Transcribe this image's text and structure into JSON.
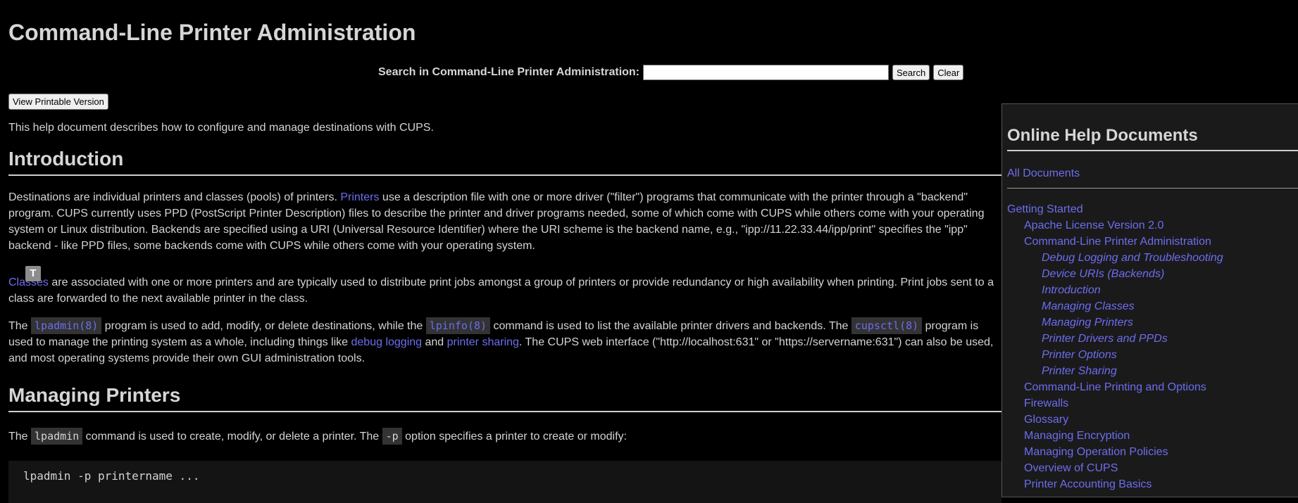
{
  "page": {
    "title": "Command-Line Printer Administration"
  },
  "search": {
    "label": "Search in Command-Line Printer Administration:",
    "value": "",
    "placeholder": "",
    "search_label": "Search",
    "clear_label": "Clear"
  },
  "print_button": "View Printable Version",
  "intro_line": "This help document describes how to configure and manage destinations with CUPS.",
  "sections": {
    "introduction": "Introduction",
    "managing_printers": "Managing Printers"
  },
  "badge": "T",
  "p1": {
    "a": "Destinations are individual printers and classes (pools) of printers. ",
    "link": "Printers",
    "b": " use a description file with one or more driver (\"filter\") programs that communicate with the printer through a \"backend\" program. CUPS currently uses PPD (PostScript Printer Description) files to describe the printer and driver programs needed, some of which come with CUPS while others come with your operating system or Linux distribution. Backends are specified using a URI (Universal Resource Identifier) where the URI scheme is the backend name, e.g., \"ipp://11.22.33.44/ipp/print\" specifies the \"ipp\" backend - like PPD files, some backends come with CUPS while others come with your operating system."
  },
  "p2": {
    "link": "Classes",
    "b": " are associated with one or more printers and are typically used to distribute print jobs amongst a group of printers or provide redundancy or high availability when printing. Print jobs sent to a class are forwarded to the next available printer in the class."
  },
  "p3": {
    "a": "The ",
    "code1": "lpadmin(8)",
    "b": " program is used to add, modify, or delete destinations, while the ",
    "code2": "lpinfo(8)",
    "c": " command is used to list the available printer drivers and backends. The ",
    "code3": "cupsctl(8)",
    "d": " program is used to manage the printing system as a whole, including things like ",
    "link1": "debug logging",
    "e": " and ",
    "link2": "printer sharing",
    "f": ". The CUPS web interface (\"http://localhost:631\" or \"https://servername:631\") can also be used, and most operating systems provide their own GUI administration tools."
  },
  "p4": {
    "a": "The ",
    "code1": "lpadmin",
    "b": " command is used to create, modify, or delete a printer. The ",
    "code2": "-p",
    "c": " option specifies a printer to create or modify:"
  },
  "code_example": "lpadmin -p printername ...",
  "sidebar": {
    "title": "Online Help Documents",
    "all_documents": "All Documents",
    "items": [
      {
        "label": "Getting Started",
        "level": 0
      },
      {
        "label": "Apache License Version 2.0",
        "level": 1
      },
      {
        "label": "Command-Line Printer Administration",
        "level": 1
      },
      {
        "label": "Debug Logging and Troubleshooting",
        "level": 2
      },
      {
        "label": "Device URIs (Backends)",
        "level": 2
      },
      {
        "label": "Introduction",
        "level": 2
      },
      {
        "label": "Managing Classes",
        "level": 2
      },
      {
        "label": "Managing Printers",
        "level": 2
      },
      {
        "label": "Printer Drivers and PPDs",
        "level": 2
      },
      {
        "label": "Printer Options",
        "level": 2
      },
      {
        "label": "Printer Sharing",
        "level": 2
      },
      {
        "label": "Command-Line Printing and Options",
        "level": 1
      },
      {
        "label": "Firewalls",
        "level": 1
      },
      {
        "label": "Glossary",
        "level": 1
      },
      {
        "label": "Managing Encryption",
        "level": 1
      },
      {
        "label": "Managing Operation Policies",
        "level": 1
      },
      {
        "label": "Overview of CUPS",
        "level": 1
      },
      {
        "label": "Printer Accounting Basics",
        "level": 1
      }
    ]
  },
  "colors": {
    "background": "#000000",
    "text": "#d4d4d4",
    "link": "#6d6df0",
    "code_bg": "#333333"
  }
}
